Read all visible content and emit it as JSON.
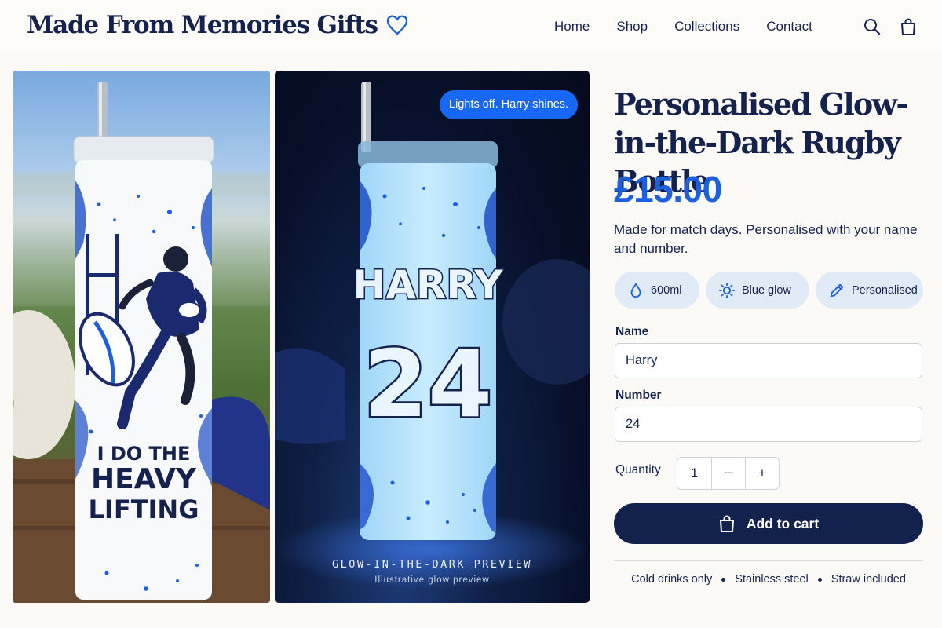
{
  "header": {
    "brand": "Made From Memories Gifts",
    "nav": [
      "Home",
      "Shop",
      "Collections",
      "Contact"
    ],
    "icons": [
      "search-icon",
      "shopping-bag-icon",
      "heart-icon"
    ]
  },
  "gallery": {
    "image1": {
      "print_lines": [
        "I DO THE",
        "HEAVY",
        "LIFTING"
      ]
    },
    "image2": {
      "badge": "Lights off. Harry shines.",
      "name": "HARRY",
      "number": "24",
      "caption_title": "GLOW-IN-THE-DARK PREVIEW",
      "caption_sub": "Illustrative glow preview"
    }
  },
  "product": {
    "title": "Personalised Glow-in-the-Dark Rugby Bottle",
    "price": "£15.00",
    "description": "Made for match days. Personalised with your name and number.",
    "chips": [
      {
        "label": "600ml",
        "icon": "droplet-icon"
      },
      {
        "label": "Blue glow",
        "icon": "sun-icon"
      },
      {
        "label": "Personalised",
        "icon": "pencil-icon"
      }
    ],
    "name_label": "Name",
    "name_value": "Harry",
    "number_label": "Number",
    "number_value": "24",
    "quantity_label": "Quantity",
    "quantity_value": "1",
    "minus": "−",
    "plus": "+",
    "add_to_cart": "Add to cart",
    "features": [
      "Cold drinks only",
      "Stainless steel",
      "Straw included"
    ]
  },
  "colors": {
    "navy": "#15224d",
    "accent_blue": "#1d5fdc",
    "badge_blue": "#1769f5",
    "chip_bg": "#e1ebf8"
  }
}
